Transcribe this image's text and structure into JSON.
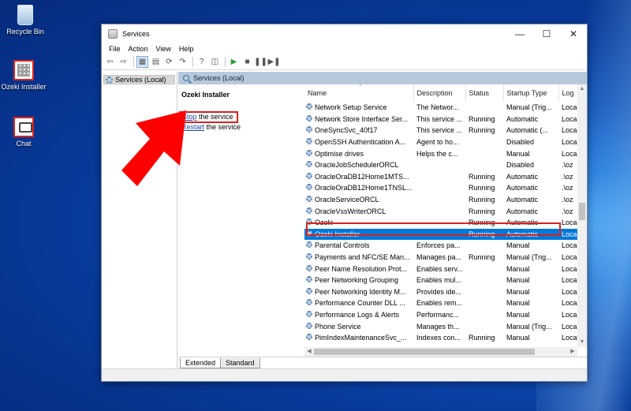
{
  "desktop": {
    "icons": [
      {
        "label": "Recycle Bin"
      },
      {
        "label": "Ozeki Installer"
      },
      {
        "label": "Chat"
      }
    ]
  },
  "window": {
    "title": "Services",
    "menu": [
      "File",
      "Action",
      "View",
      "Help"
    ]
  },
  "tree": {
    "root": "Services (Local)"
  },
  "header": {
    "title": "Services (Local)"
  },
  "detail": {
    "title": "Ozeki Installer",
    "stop_link": "Stop",
    "stop_suffix": " the service",
    "restart_link": "Restart",
    "restart_suffix": " the service"
  },
  "columns": [
    "Name",
    "Description",
    "Status",
    "Startup Type",
    "Log"
  ],
  "rows": [
    {
      "name": "Network Setup Service",
      "desc": "The Networ...",
      "status": "",
      "startup": "Manual (Trig...",
      "log": "Loca"
    },
    {
      "name": "Network Store Interface Ser...",
      "desc": "This service ...",
      "status": "Running",
      "startup": "Automatic",
      "log": "Loca"
    },
    {
      "name": "OneSyncSvc_40f17",
      "desc": "This service ...",
      "status": "Running",
      "startup": "Automatic (...",
      "log": "Loca"
    },
    {
      "name": "OpenSSH Authentication A...",
      "desc": "Agent to ho...",
      "status": "",
      "startup": "Disabled",
      "log": "Loca"
    },
    {
      "name": "Optimise drives",
      "desc": "Helps the c...",
      "status": "",
      "startup": "Manual",
      "log": "Loca"
    },
    {
      "name": "OracleJobSchedulerORCL",
      "desc": "",
      "status": "",
      "startup": "Disabled",
      "log": ".\\oz"
    },
    {
      "name": "OracleOraDB12Home1MTS...",
      "desc": "",
      "status": "Running",
      "startup": "Automatic",
      "log": ".\\oz"
    },
    {
      "name": "OracleOraDB12Home1TNSL...",
      "desc": "",
      "status": "Running",
      "startup": "Automatic",
      "log": ".\\oz"
    },
    {
      "name": "OracleServiceORCL",
      "desc": "",
      "status": "Running",
      "startup": "Automatic",
      "log": ".\\oz"
    },
    {
      "name": "OracleVssWriterORCL",
      "desc": "",
      "status": "Running",
      "startup": "Automatic",
      "log": ".\\oz"
    },
    {
      "name": "Ozeki",
      "desc": "",
      "status": "Running",
      "startup": "Automatic",
      "log": "Loca"
    },
    {
      "name": "Ozeki Installer",
      "desc": "",
      "status": "Running",
      "startup": "Automatic",
      "log": "Loca",
      "selected": true
    },
    {
      "name": "Parental Controls",
      "desc": "Enforces pa...",
      "status": "",
      "startup": "Manual",
      "log": "Loca"
    },
    {
      "name": "Payments and NFC/SE Man...",
      "desc": "Manages pa...",
      "status": "Running",
      "startup": "Manual (Trig...",
      "log": "Loca"
    },
    {
      "name": "Peer Name Resolution Prot...",
      "desc": "Enables serv...",
      "status": "",
      "startup": "Manual",
      "log": "Loca"
    },
    {
      "name": "Peer Networking Grouping",
      "desc": "Enables mul...",
      "status": "",
      "startup": "Manual",
      "log": "Loca"
    },
    {
      "name": "Peer Networking Identity M...",
      "desc": "Provides ide...",
      "status": "",
      "startup": "Manual",
      "log": "Loca"
    },
    {
      "name": "Performance Counter DLL ...",
      "desc": "Enables rem...",
      "status": "",
      "startup": "Manual",
      "log": "Loca"
    },
    {
      "name": "Performance Logs & Alerts",
      "desc": "Performanc...",
      "status": "",
      "startup": "Manual",
      "log": "Loca"
    },
    {
      "name": "Phone Service",
      "desc": "Manages th...",
      "status": "",
      "startup": "Manual (Trig...",
      "log": "Loca"
    },
    {
      "name": "PimIndexMaintenanceSvc_...",
      "desc": "Indexes con...",
      "status": "Running",
      "startup": "Manual",
      "log": "Loca"
    }
  ],
  "tabs": [
    "Extended",
    "Standard"
  ],
  "colors": {
    "selection": "#0078d7",
    "highlight": "#d9231d",
    "header": "#b8c9dc"
  }
}
